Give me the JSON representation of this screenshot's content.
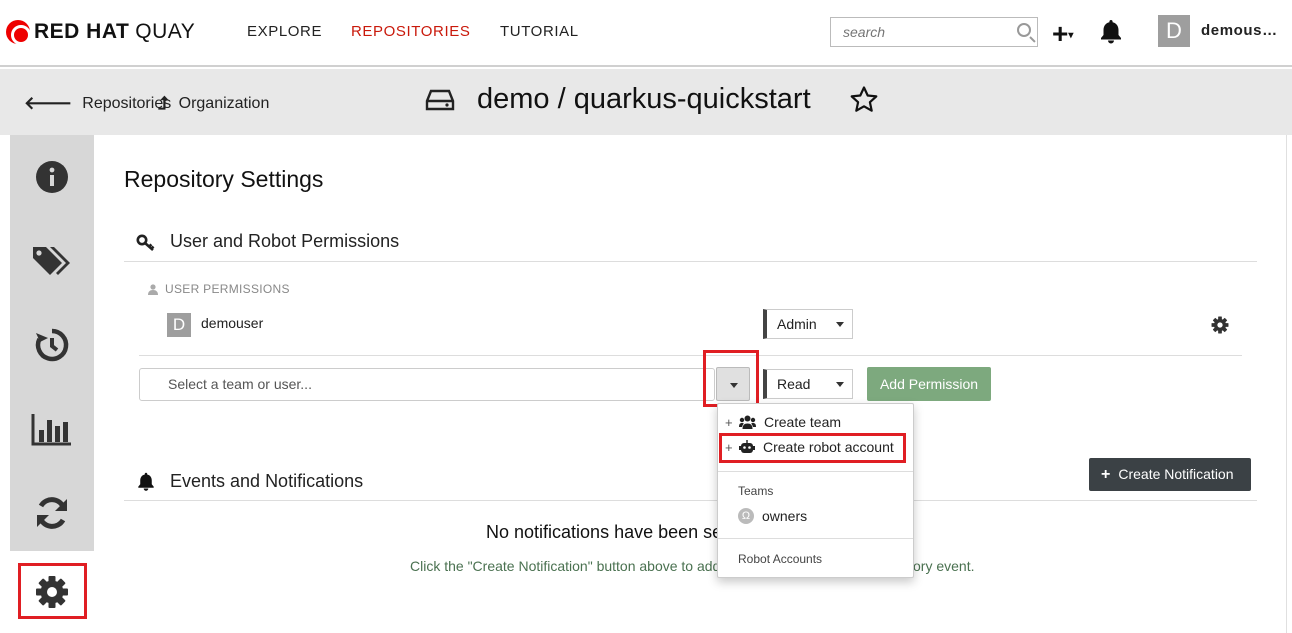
{
  "navbar": {
    "logo_bold": "RED HAT",
    "logo_rest": "QUAY",
    "links": [
      "EXPLORE",
      "REPOSITORIES",
      "TUTORIAL"
    ],
    "search_placeholder": "search",
    "avatar_letter": "D",
    "username": "demous…"
  },
  "breadcrumb": {
    "back_label": "Repositories",
    "org_label": "Organization",
    "repo_title": "demo / quarkus-quickstart"
  },
  "settings": {
    "heading": "Repository Settings",
    "permissions_title": "User and Robot Permissions",
    "user_permissions_label": "USER PERMISSIONS",
    "user": {
      "avatar_letter": "D",
      "name": "demouser",
      "role": "Admin"
    },
    "typeahead_placeholder": "Select a team or user...",
    "new_role": "Read",
    "add_permission_label": "Add Permission"
  },
  "dropdown": {
    "create_team": "Create team",
    "create_robot": "Create robot account",
    "teams_header": "Teams",
    "team_owners": "owners",
    "team_icon_glyph": "Ω",
    "robots_header": "Robot Accounts"
  },
  "notifications": {
    "title": "Events and Notifications",
    "create_label": "Create Notification",
    "empty_message": "No notifications have been se",
    "hint": "Click the \"Create Notification\" button above to add",
    "hint_tail": "ory event."
  },
  "colors": {
    "accent_red": "#c9190b",
    "highlight_red": "#e01e23",
    "add_permission_green": "#7da97e",
    "dark_button": "#3b4145"
  }
}
